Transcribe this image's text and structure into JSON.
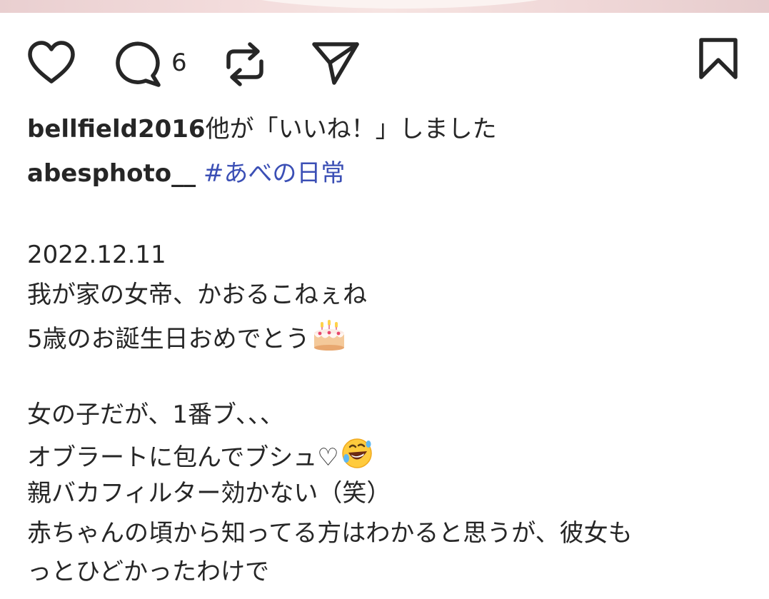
{
  "post": {
    "comment_count": "6",
    "likes_line": {
      "user": "bellfield2016",
      "suffix": "他が「いいね！」しました"
    },
    "caption": {
      "author": "abesphoto__",
      "hashtag": "#あべの日常",
      "lines": [
        "2022.12.11",
        "我が家の女帝、かおるこねぇね",
        "5歳のお誕生日おめでとう",
        "",
        "女の子だが、1番ブ、、、",
        "オブラートに包んでブシュ♡",
        "親バカフィルター効かない（笑）",
        "赤ちゃんの頃から知ってる方はわかると思うが、彼女も",
        "っとひどかったわけで"
      ]
    }
  },
  "icons": {
    "like": "heart-outline-icon",
    "comment": "comment-bubble-icon",
    "repost": "repost-arrows-icon",
    "share": "paper-plane-icon",
    "save": "bookmark-icon",
    "emoji_cake": "birthday-cake-emoji",
    "emoji_laugh": "rolling-laughing-emoji"
  }
}
